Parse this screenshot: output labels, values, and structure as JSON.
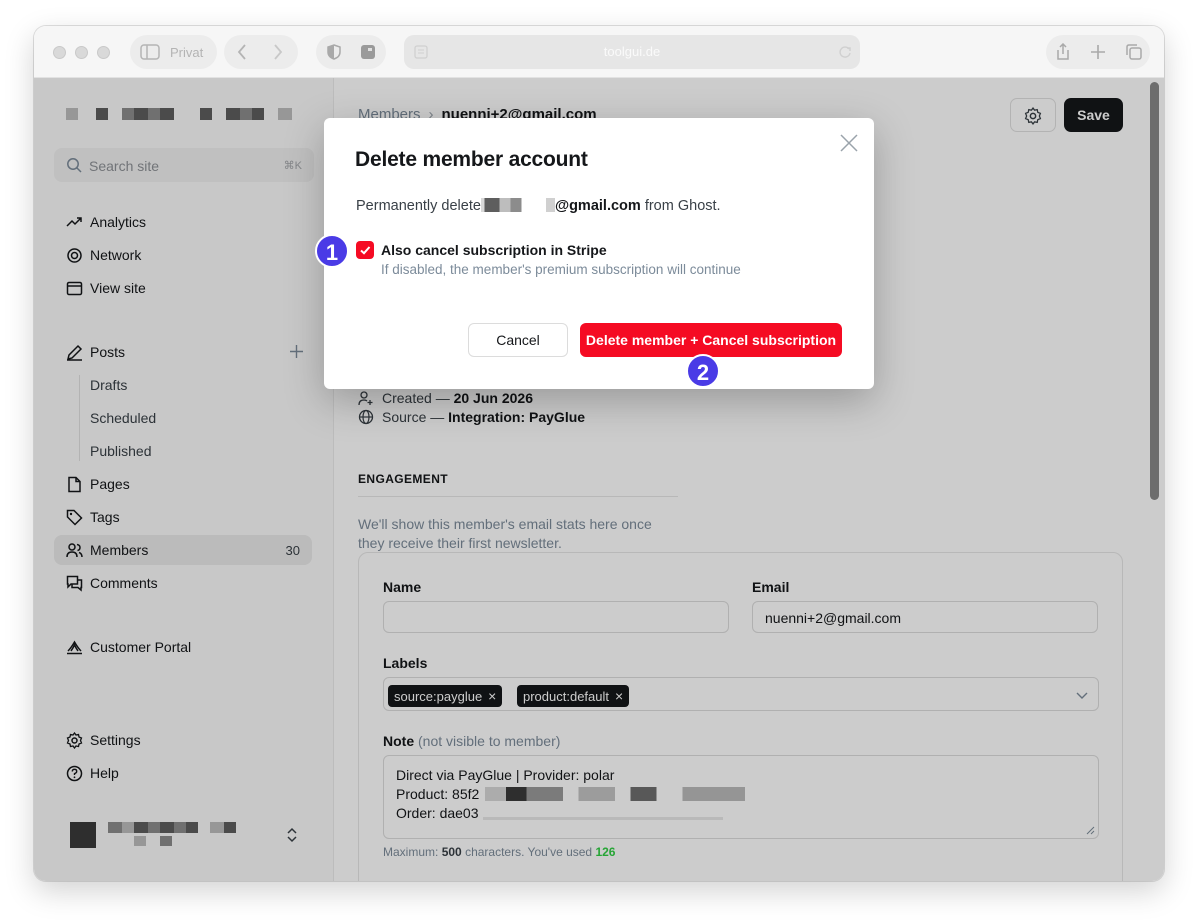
{
  "browser": {
    "tab_label": "Privat",
    "url": "toolgui.de"
  },
  "sidebar": {
    "search_placeholder": "Search site",
    "search_shortcut": "⌘K",
    "items": {
      "analytics": "Analytics",
      "network": "Network",
      "view_site": "View site",
      "posts": "Posts",
      "drafts": "Drafts",
      "scheduled": "Scheduled",
      "published": "Published",
      "pages": "Pages",
      "tags": "Tags",
      "members": "Members",
      "members_count": "30",
      "comments": "Comments",
      "customer_portal": "Customer Portal",
      "settings": "Settings",
      "help": "Help"
    }
  },
  "header": {
    "breadcrumb_parent": "Members",
    "breadcrumb_current": "nuenni+2@gmail.com",
    "save_label": "Save"
  },
  "member": {
    "created_prefix": "Created —",
    "created_value": "20 Jun 2026",
    "source_prefix": "Source —",
    "source_value": "Integration: PayGlue"
  },
  "engagement": {
    "heading": "ENGAGEMENT",
    "text": "We'll show this member's email stats here once they receive their first newsletter."
  },
  "form": {
    "name_label": "Name",
    "name_value": "",
    "email_label": "Email",
    "email_value": "nuenni+2@gmail.com",
    "labels_label": "Labels",
    "labels": [
      "source:payglue",
      "product:default"
    ],
    "note_label": "Note",
    "note_muted": "(not visible to member)",
    "note_lines": [
      "Direct via PayGlue | Provider: polar",
      "Product: 85f2",
      "Order: dae03"
    ],
    "hint_prefix": "Maximum:",
    "hint_max": "500",
    "hint_middle": "characters. You've used",
    "hint_used": "126"
  },
  "modal": {
    "title": "Delete member account",
    "desc_prefix": "Permanently delete",
    "desc_email": "@gmail.com",
    "desc_suffix": "from Ghost.",
    "checkbox_label": "Also cancel subscription in Stripe",
    "checkbox_checked": true,
    "checkbox_help": "If disabled, the member's premium subscription will continue",
    "cancel_label": "Cancel",
    "delete_label": "Delete member + Cancel subscription"
  },
  "markers": [
    "1",
    "2"
  ],
  "colors": {
    "danger": "#f50b23",
    "marker": "#4a3be6",
    "success_count": "#30cf43",
    "dark": "#15171a"
  },
  "icons": [
    "search-icon",
    "analytics-icon",
    "network-icon",
    "view-site-icon",
    "posts-icon",
    "add-icon",
    "pages-icon",
    "tags-icon",
    "members-icon",
    "comments-icon",
    "customer-portal-icon",
    "settings-icon",
    "help-icon",
    "chevron-updown-icon",
    "gear-icon",
    "close-icon",
    "check-icon",
    "chevron-down-icon"
  ]
}
